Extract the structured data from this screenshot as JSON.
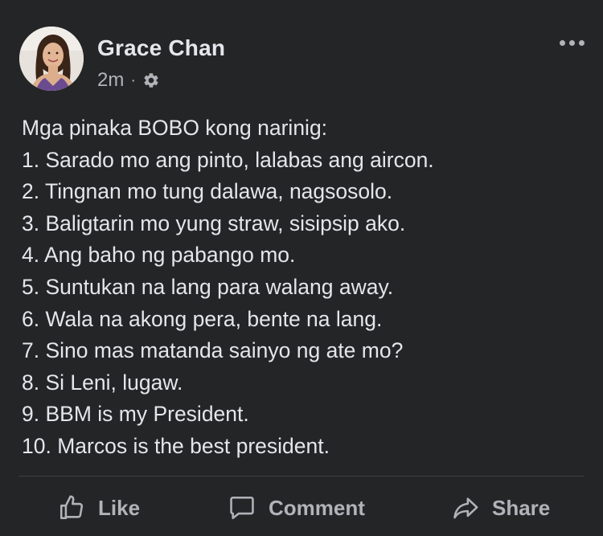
{
  "post": {
    "author": "Grace Chan",
    "time": "2m",
    "separator": "·",
    "privacy_icon": "gear-icon",
    "more_icon": "ellipsis-icon",
    "lines": [
      "Mga pinaka BOBO kong narinig:",
      "1. Sarado mo ang pinto, lalabas ang aircon.",
      "2. Tingnan mo tung dalawa, nagsosolo.",
      "3. Baligtarin mo yung straw, sisipsip ako.",
      "4. Ang baho ng pabango mo.",
      "5. Suntukan na lang para walang away.",
      "6. Wala na akong pera, bente na lang.",
      "7. Sino mas matanda sainyo ng ate mo?",
      "8. Si Leni, lugaw.",
      "9. BBM is my President.",
      "10. Marcos is the best president."
    ]
  },
  "actions": {
    "like": {
      "label": "Like",
      "icon": "thumbs-up-icon"
    },
    "comment": {
      "label": "Comment",
      "icon": "comment-icon"
    },
    "share": {
      "label": "Share",
      "icon": "share-icon"
    }
  },
  "colors": {
    "background": "#242526",
    "primary_text": "#e4e6eb",
    "secondary_text": "#b0b3b8",
    "divider": "#3e4042"
  }
}
